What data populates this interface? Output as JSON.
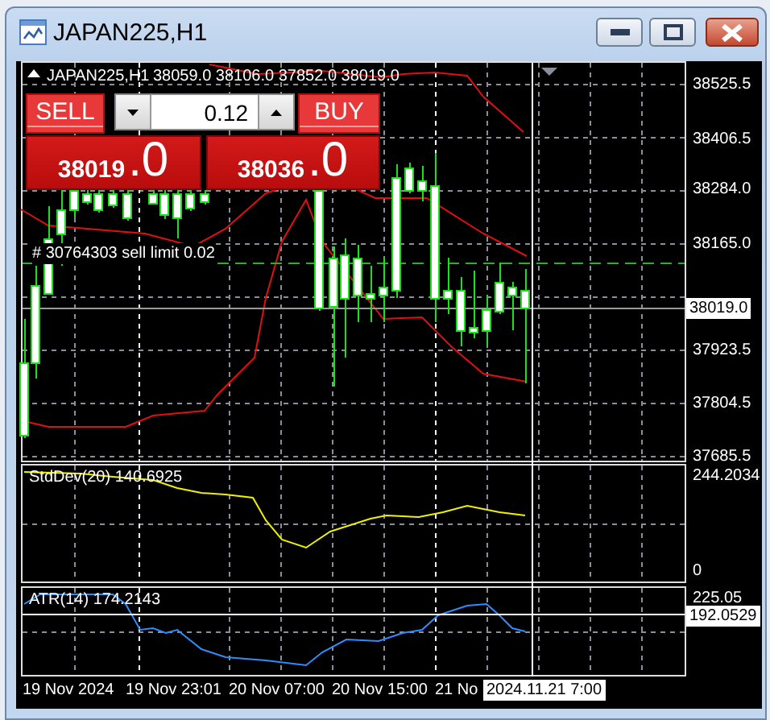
{
  "window": {
    "title": "JAPAN225,H1"
  },
  "chart": {
    "header": {
      "symbol": "JAPAN225,H1",
      "ohlc": "38059.0 38106.0 37852.0 38019.0"
    },
    "order_label": "#  30764303 sell limit 0.02",
    "price_axis": [
      "38525.5",
      "38406.5",
      "38284.0",
      "38165.0",
      "37923.5",
      "37804.5",
      "37685.5"
    ],
    "current_price": "38019.0"
  },
  "trade_panel": {
    "sell_label": "SELL",
    "buy_label": "BUY",
    "volume": "0.12",
    "sell_price": "38019",
    "sell_price_big": ".0",
    "buy_price": "38036",
    "buy_price_big": ".0"
  },
  "indicators": [
    {
      "kind": "stddev",
      "label": "StdDev(20) 140.6925",
      "axis": [
        "244.2034",
        "0"
      ]
    },
    {
      "kind": "atr",
      "label": "ATR(14) 174.2143",
      "axis": [
        "225.05"
      ],
      "current_value": "192.0529"
    }
  ],
  "time_axis": {
    "labels": [
      "19 Nov 2024",
      "19 Nov 23:01",
      "20 Nov 07:00",
      "20 Nov 15:00",
      "21 No"
    ],
    "crosshair_time": "2024.11.21 7:00"
  }
}
